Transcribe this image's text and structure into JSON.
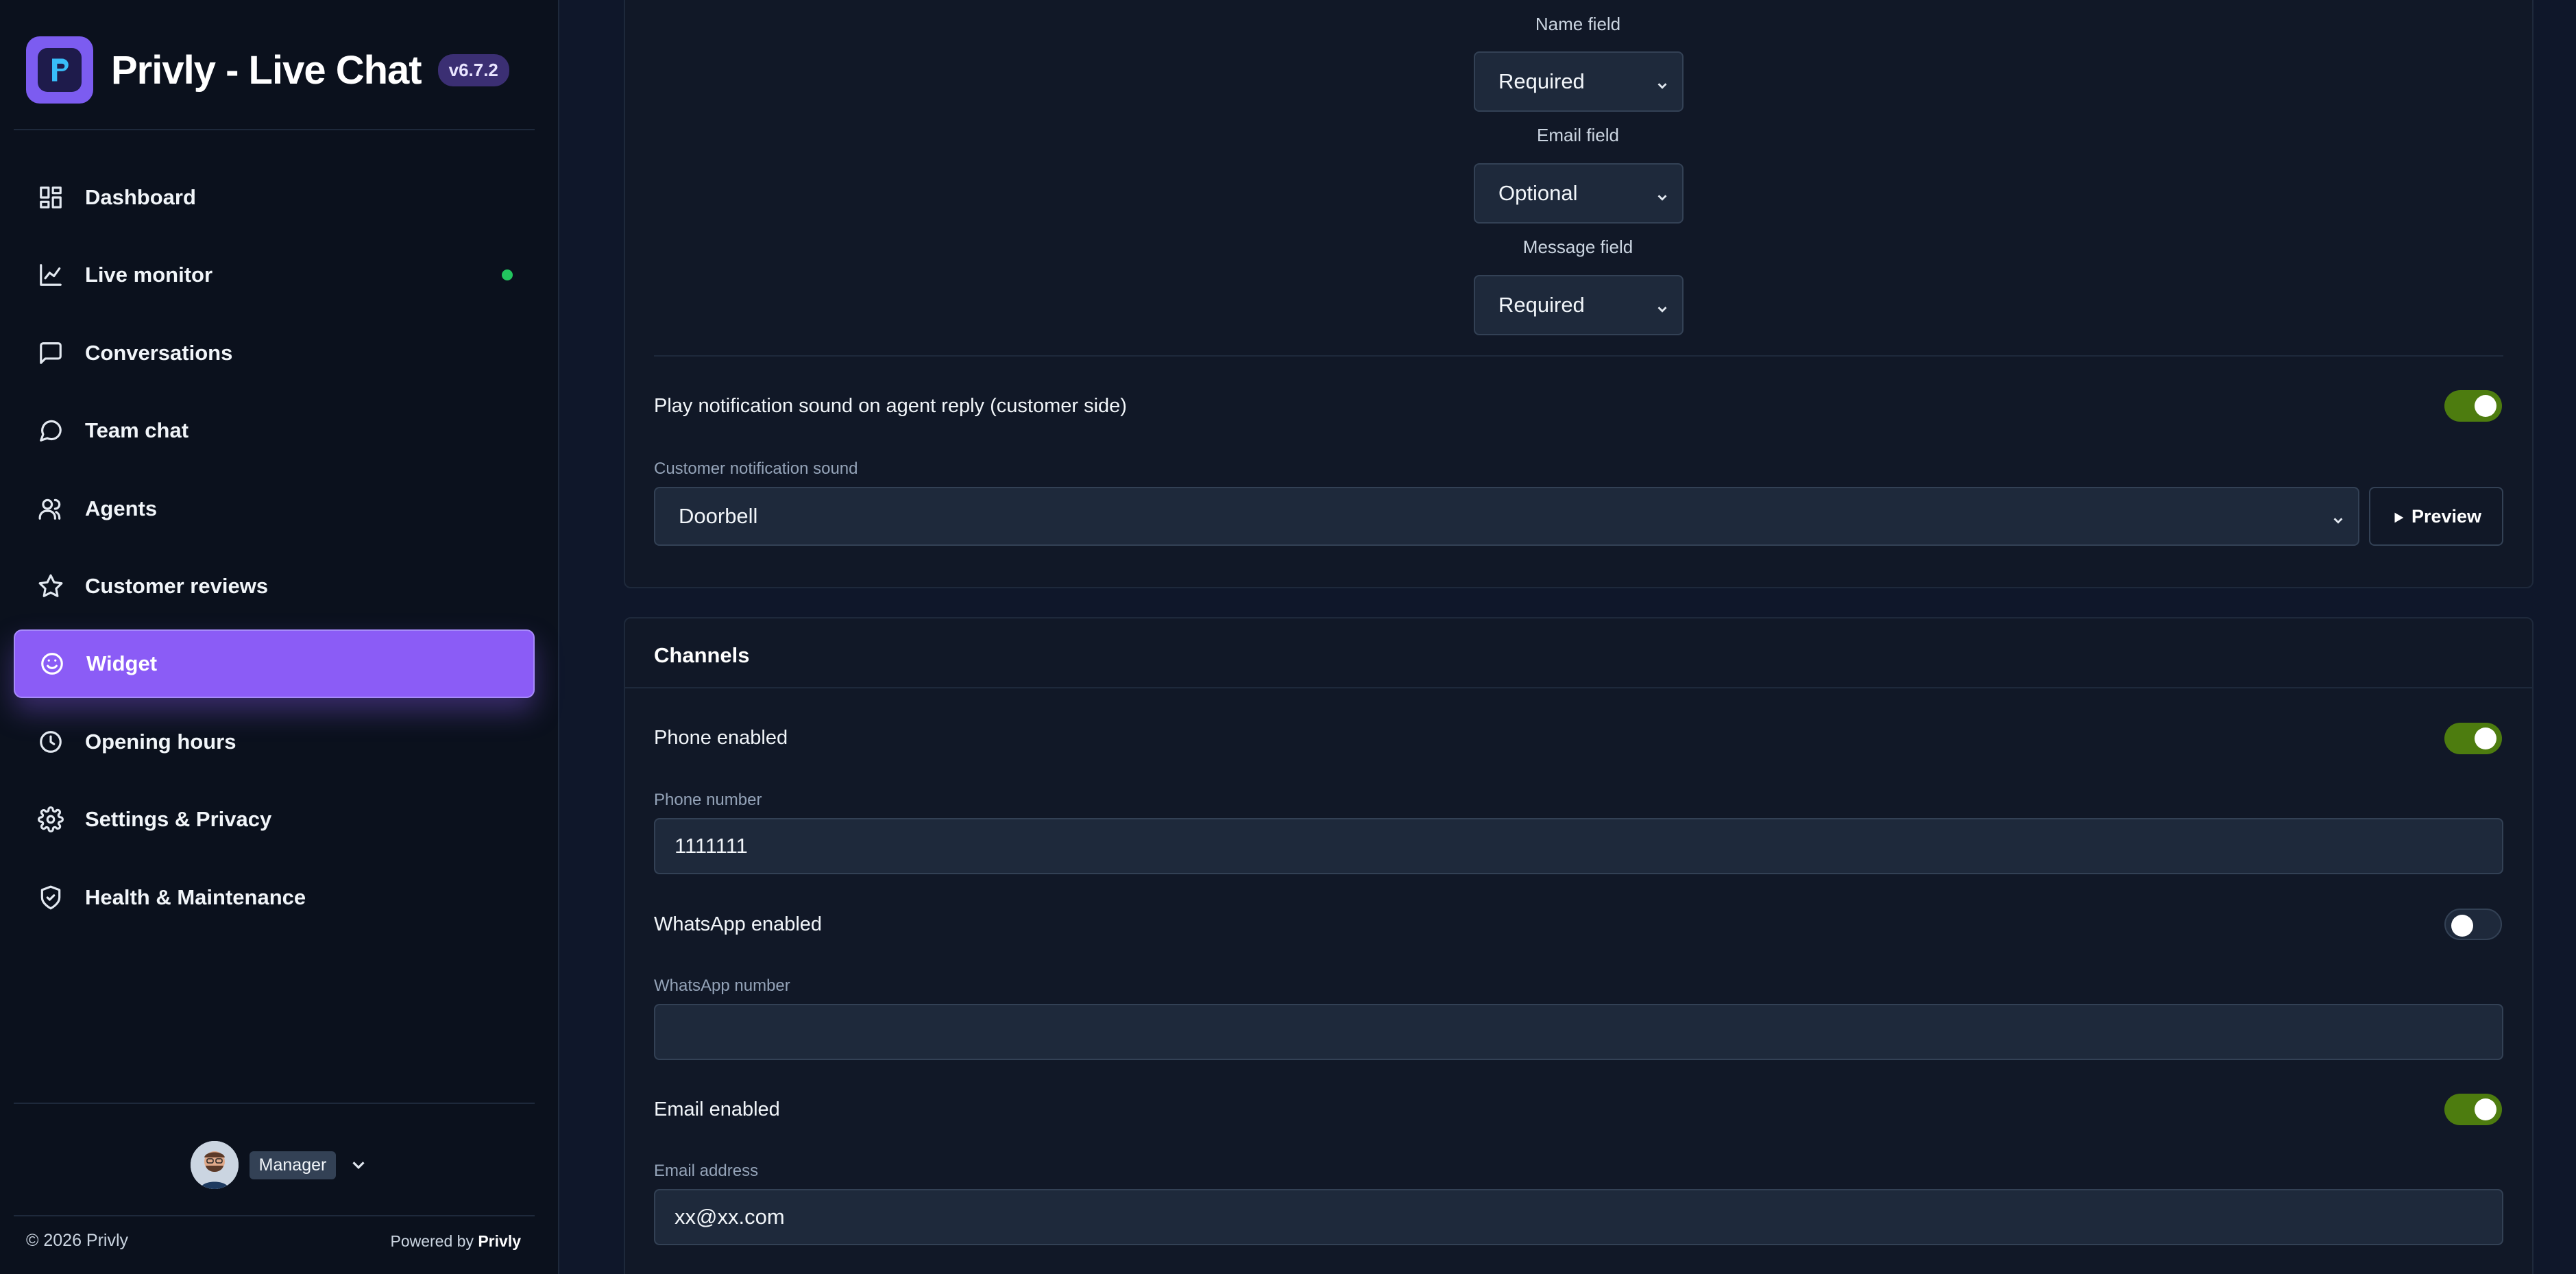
{
  "brand": {
    "title": "Privly - Live Chat",
    "version": "v6.7.2"
  },
  "sidebar": {
    "items": [
      {
        "label": "Dashboard",
        "icon": "dashboard-grid-icon"
      },
      {
        "label": "Live monitor",
        "icon": "chart-line-icon"
      },
      {
        "label": "Conversations",
        "icon": "message-square-icon"
      },
      {
        "label": "Team chat",
        "icon": "message-circle-icon"
      },
      {
        "label": "Agents",
        "icon": "users-icon"
      },
      {
        "label": "Customer reviews",
        "icon": "star-icon"
      },
      {
        "label": "Widget",
        "icon": "smile-icon",
        "active": true
      },
      {
        "label": "Opening hours",
        "icon": "clock-icon"
      },
      {
        "label": "Settings & Privacy",
        "icon": "gear-icon"
      },
      {
        "label": "Health & Maintenance",
        "icon": "shield-check-icon"
      }
    ],
    "user": {
      "role": "Manager"
    },
    "footer": {
      "copyright": "© 2026 Privly",
      "powered_prefix": "Powered by",
      "powered_brand": "Privly"
    }
  },
  "form_fields": {
    "name_label": "Name field",
    "name_value": "Required",
    "email_label": "Email field",
    "email_value": "Optional",
    "message_label": "Message field",
    "message_value": "Required"
  },
  "notification": {
    "sound_toggle_label": "Play notification sound on agent reply (customer side)",
    "sound_toggle_on": true,
    "sound_label": "Customer notification sound",
    "sound_value": "Doorbell",
    "preview_label": "Preview"
  },
  "channels": {
    "title": "Channels",
    "phone_enabled_label": "Phone enabled",
    "phone_enabled": true,
    "phone_number_label": "Phone number",
    "phone_number": "1111111",
    "whatsapp_enabled_label": "WhatsApp enabled",
    "whatsapp_enabled": false,
    "whatsapp_number_label": "WhatsApp number",
    "whatsapp_number": "",
    "email_enabled_label": "Email enabled",
    "email_enabled": true,
    "email_address_label": "Email address",
    "email_address": "xx@xx.com"
  },
  "colors": {
    "accent": "#8b5cf6",
    "toggle_on": "#4d7c0f",
    "live_dot": "#22c55e",
    "background": "#0f172a"
  }
}
